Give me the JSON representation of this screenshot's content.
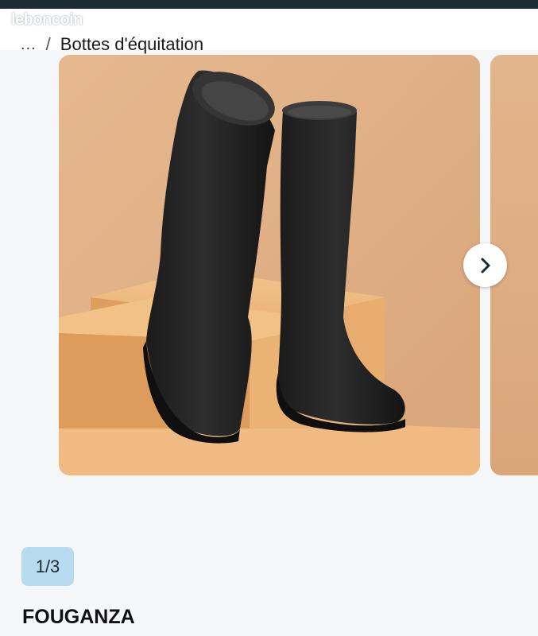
{
  "watermark": "leboncoin",
  "breadcrumb": {
    "more": "...",
    "separator": "/",
    "current": "Bottes d'équitation"
  },
  "gallery": {
    "counter": "1/3",
    "next_icon": "chevron-right-icon",
    "photo_subject": "black riding boots on orange blocks"
  },
  "ad": {
    "brand": "FOUGANZA"
  },
  "colors": {
    "topbar": "#1c2a33",
    "counter_bg": "#b7dcef",
    "photo_bg": "#e2b48b"
  }
}
